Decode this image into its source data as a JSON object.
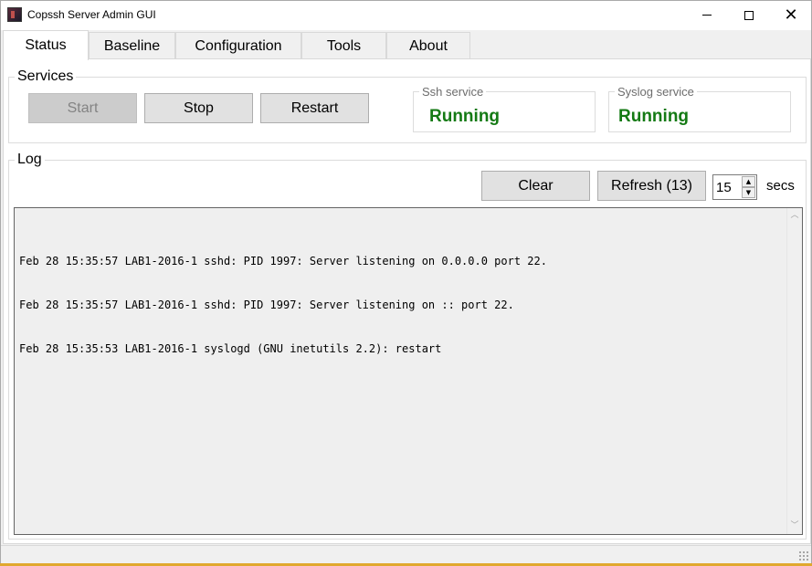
{
  "window": {
    "title": "Copssh Server Admin GUI"
  },
  "tabs": [
    {
      "label": "Status",
      "active": true
    },
    {
      "label": "Baseline",
      "active": false
    },
    {
      "label": "Configuration",
      "active": false
    },
    {
      "label": "Tools",
      "active": false
    },
    {
      "label": "About",
      "active": false
    }
  ],
  "services": {
    "legend": "Services",
    "start_label": "Start",
    "start_enabled": false,
    "stop_label": "Stop",
    "restart_label": "Restart",
    "ssh": {
      "label": "Ssh service",
      "state": "Running"
    },
    "syslog": {
      "label": "Syslog service",
      "state": "Running"
    },
    "running_color": "#147a14"
  },
  "log": {
    "legend": "Log",
    "clear_label": "Clear",
    "refresh_label": "Refresh (13)",
    "interval_value": "15",
    "interval_unit": "secs",
    "lines": [
      "Feb 28 15:35:57 LAB1-2016-1 sshd: PID 1997: Server listening on 0.0.0.0 port 22.",
      "Feb 28 15:35:57 LAB1-2016-1 sshd: PID 1997: Server listening on :: port 22.",
      "Feb 28 15:35:53 LAB1-2016-1 syslogd (GNU inetutils 2.2): restart"
    ]
  },
  "icons": {
    "app": "app-icon",
    "minimize": "minimize-icon",
    "maximize": "maximize-icon",
    "close": "close-icon",
    "spin_up": "spin-up-icon",
    "spin_down": "spin-down-icon",
    "scroll_up": "scroll-up-icon",
    "scroll_down": "scroll-down-icon",
    "grip": "resize-grip-icon"
  }
}
